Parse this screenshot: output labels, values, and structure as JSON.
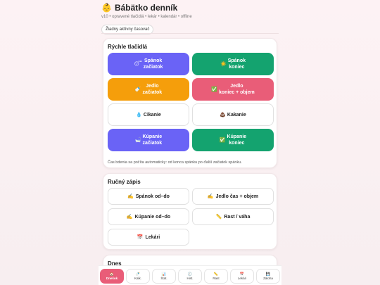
{
  "header": {
    "emoji": "👶",
    "title": "Bábätko denník",
    "subtitle": "v10 • opravené tlačidlá • lekár • kalendár • offline",
    "timer_status": "Žiadny aktívny časovač"
  },
  "quick": {
    "title": "Rýchle tlačidlá",
    "buttons": [
      {
        "icon": "😴",
        "label": "Spánok\nzačiatok",
        "color": "purple",
        "icon_name": "sleep-icon"
      },
      {
        "icon": "☀️",
        "label": "Spánok\nkoniec",
        "color": "green",
        "icon_name": "sun-icon"
      },
      {
        "icon": "🍼",
        "label": "Jedlo\nzačiatok",
        "color": "orange",
        "icon_name": "bottle-icon"
      },
      {
        "icon": "✅",
        "label": "Jedlo\nkoniec + objem",
        "color": "red",
        "icon_name": "check-icon"
      },
      {
        "icon": "💧",
        "label": "Cikanie",
        "color": "white",
        "icon_name": "droplet-icon"
      },
      {
        "icon": "💩",
        "label": "Kakanie",
        "color": "white",
        "icon_name": "poop-icon"
      },
      {
        "icon": "🛁",
        "label": "Kúpanie\nzačiatok",
        "color": "purple",
        "icon_name": "bathtub-icon"
      },
      {
        "icon": "✅",
        "label": "Kúpanie\nkoniec",
        "color": "green",
        "icon_name": "check-icon"
      }
    ],
    "note": "Čas bdenia sa počíta automaticky: od konca spánku po ďalší začiatok spánku."
  },
  "manual": {
    "title": "Ručný zápis",
    "buttons": [
      {
        "icon": "✍️",
        "label": "Spánok od–do",
        "icon_name": "writing-hand-icon"
      },
      {
        "icon": "✍️",
        "label": "Jedlo čas + objem",
        "icon_name": "writing-hand-icon"
      },
      {
        "icon": "✍️",
        "label": "Kúpanie od–do",
        "icon_name": "writing-hand-icon"
      },
      {
        "icon": "📏",
        "label": "Rast / váha",
        "icon_name": "ruler-icon"
      },
      {
        "icon": "📅",
        "label": "Lekári",
        "icon_name": "calendar-icon"
      }
    ]
  },
  "today": {
    "title": "Dnes"
  },
  "nav": [
    {
      "icon": "🏠",
      "label": "Dnešok",
      "active": true,
      "icon_name": "home-icon"
    },
    {
      "icon": "🍼",
      "label": "Kalk.",
      "active": false,
      "icon_name": "bottle-icon"
    },
    {
      "icon": "📊",
      "label": "Štat.",
      "active": false,
      "icon_name": "chart-icon"
    },
    {
      "icon": "🕘",
      "label": "Hist.",
      "active": false,
      "icon_name": "clock-icon"
    },
    {
      "icon": "📏",
      "label": "Rast",
      "active": false,
      "icon_name": "ruler-icon"
    },
    {
      "icon": "📅",
      "label": "Lekári",
      "active": false,
      "icon_name": "calendar-icon"
    },
    {
      "icon": "💾",
      "label": "Záloha",
      "active": false,
      "icon_name": "save-icon"
    }
  ],
  "colors": {
    "purple": "#6a63f6",
    "green": "#14a36f",
    "orange": "#f59e0b",
    "red": "#e95d78",
    "accent": "#e95d78"
  }
}
